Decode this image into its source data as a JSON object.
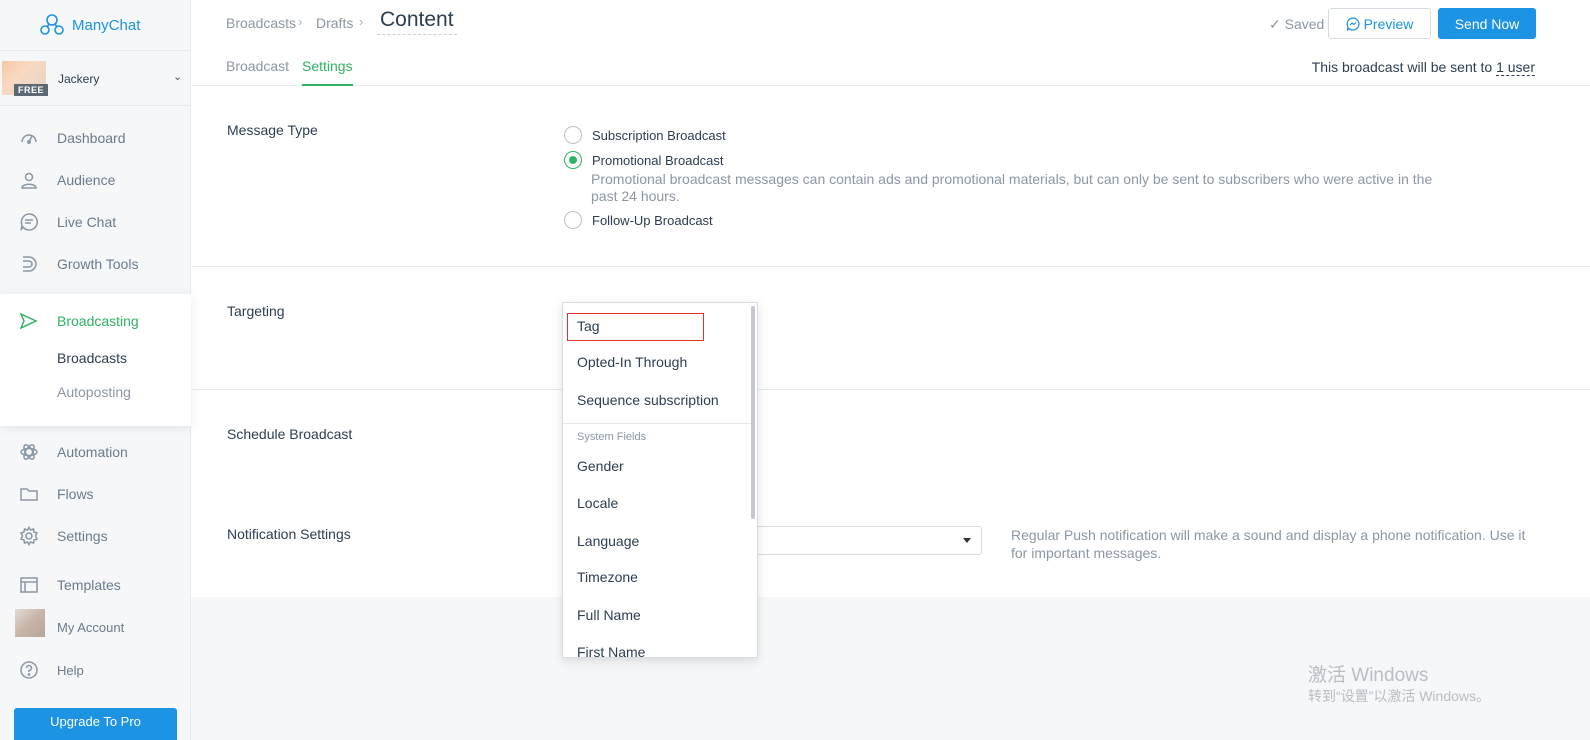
{
  "app": {
    "name": "ManyChat"
  },
  "account": {
    "name": "Jackery",
    "plan_badge": "FREE"
  },
  "sidebar": {
    "items": [
      {
        "label": "Dashboard",
        "icon": "dashboard-icon"
      },
      {
        "label": "Audience",
        "icon": "user-icon"
      },
      {
        "label": "Live Chat",
        "icon": "chat-icon"
      },
      {
        "label": "Growth Tools",
        "icon": "magnet-icon"
      },
      {
        "label": "Broadcasting",
        "icon": "send-icon",
        "active": true
      },
      {
        "label": "Automation",
        "icon": "atom-icon"
      },
      {
        "label": "Flows",
        "icon": "folder-icon"
      },
      {
        "label": "Settings",
        "icon": "gear-icon"
      },
      {
        "label": "Templates",
        "icon": "template-icon"
      },
      {
        "label": "My Account",
        "icon": "avatar"
      },
      {
        "label": "Help",
        "icon": "help-icon"
      }
    ],
    "broadcasting_sub": [
      {
        "label": "Broadcasts",
        "active": true
      },
      {
        "label": "Autoposting",
        "active": false
      }
    ],
    "upgrade_label": "Upgrade To Pro"
  },
  "header": {
    "breadcrumbs": [
      "Broadcasts",
      "Drafts"
    ],
    "title": "Content",
    "saved_label": "Saved",
    "preview_label": "Preview",
    "send_label": "Send Now",
    "tabs": [
      {
        "label": "Broadcast",
        "active": false
      },
      {
        "label": "Settings",
        "active": true
      }
    ],
    "recipients_prefix": "This broadcast will be sent to",
    "recipients_link": "1 user"
  },
  "settings": {
    "message_type": {
      "label": "Message Type",
      "options": [
        {
          "label": "Subscription Broadcast",
          "selected": false
        },
        {
          "label": "Promotional Broadcast",
          "selected": true
        },
        {
          "label": "Follow-Up Broadcast",
          "selected": false
        }
      ],
      "promo_description": "Promotional broadcast messages can contain ads and promotional materials, but can only be sent to subscribers who were active in the past 24 hours."
    },
    "targeting_label": "Targeting",
    "schedule_label": "Schedule Broadcast",
    "notification": {
      "label": "Notification Settings",
      "description": "Regular Push notification will make a sound and display a phone notification. Use it for important messages."
    }
  },
  "targeting_dropdown": {
    "items": [
      "Tag",
      "Opted-In Through",
      "Sequence subscription"
    ],
    "group_label": "System Fields",
    "system_fields": [
      "Gender",
      "Locale",
      "Language",
      "Timezone",
      "Full Name",
      "First Name"
    ]
  },
  "windows_watermark": {
    "line1": "激活 Windows",
    "line2": "转到“设置”以激活 Windows。"
  },
  "colors": {
    "accent_green": "#2fb264",
    "accent_blue": "#1c93e3",
    "highlight_red": "#e2302a"
  }
}
